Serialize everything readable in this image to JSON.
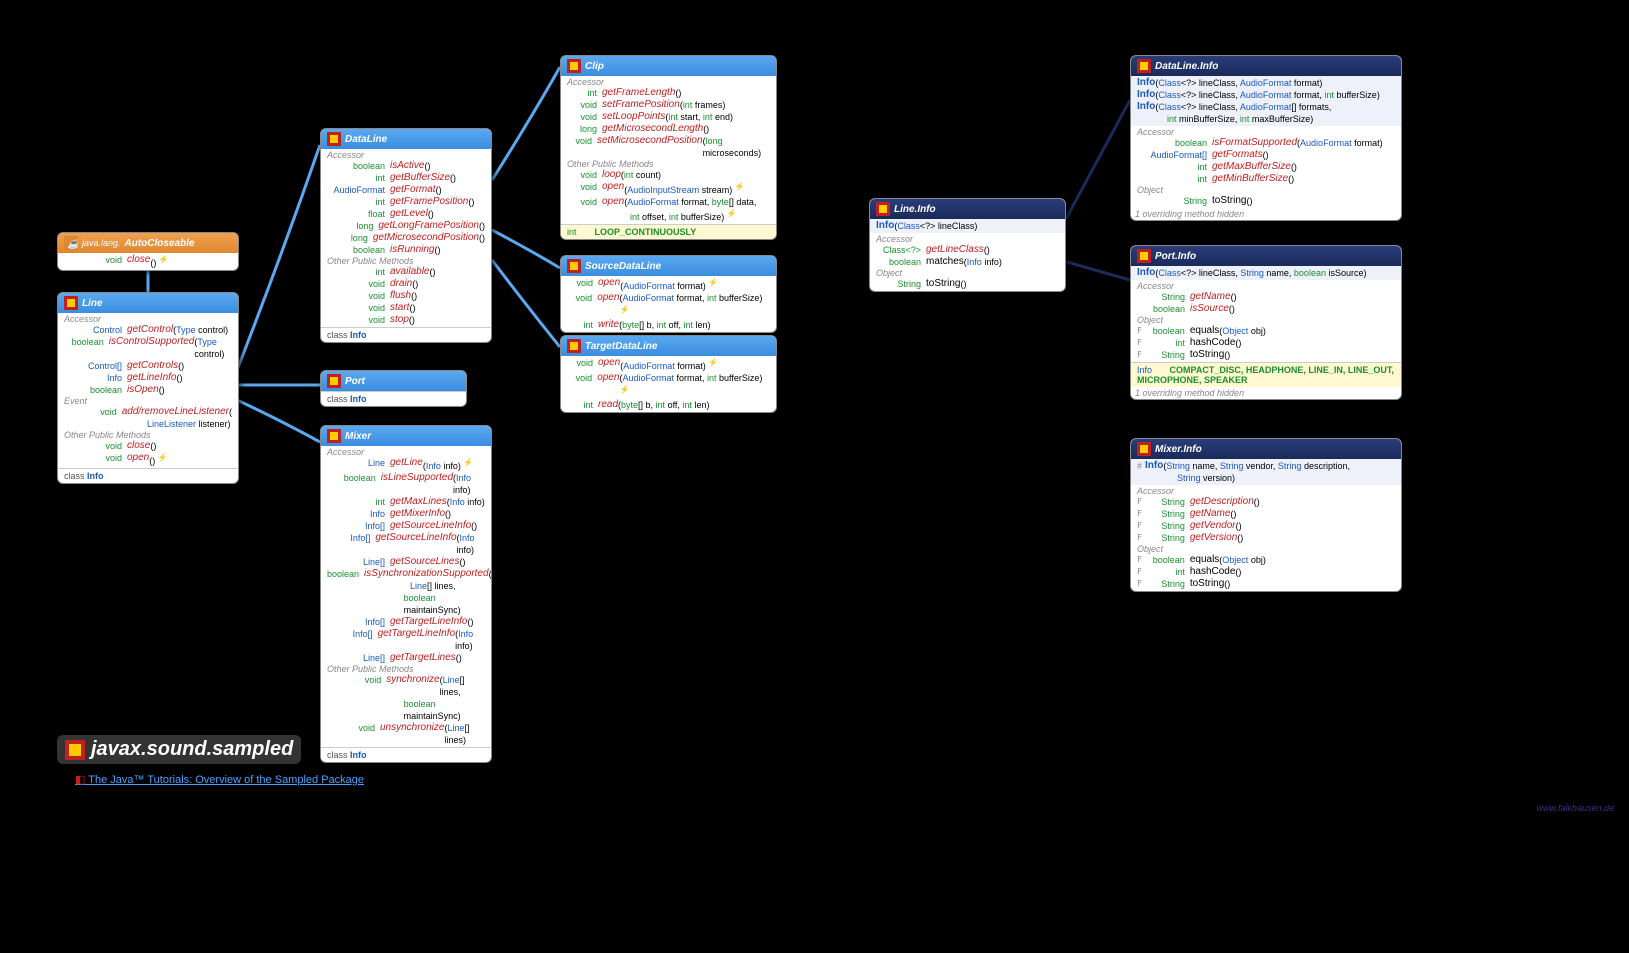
{
  "package": "javax.sound.sampled",
  "tutorial": "The Java™ Tutorials: Overview of the Sampled Package",
  "site": "www.falkhausen.de",
  "autocloseable": {
    "title": "AutoCloseable",
    "pkg": "java.lang.",
    "rows": [
      {
        "t": "void",
        "n": "close",
        "thr": true
      }
    ]
  },
  "line": {
    "title": "Line",
    "s1": "Accessor",
    "r1": [
      {
        "t": "Control",
        "tb": true,
        "n": "getControl",
        "p": "(Type control)"
      },
      {
        "t": "boolean",
        "n": "isControlSupported",
        "p": "(Type control)"
      },
      {
        "t": "Control[]",
        "tb": true,
        "n": "getControls",
        "p": "()"
      },
      {
        "t": "Info",
        "tb": true,
        "n": "getLineInfo",
        "p": "()"
      },
      {
        "t": "boolean",
        "n": "isOpen",
        "p": "()"
      }
    ],
    "s2": "Event",
    "r2": [
      {
        "t": "void",
        "n": "add/removeLineListener",
        "p": "(",
        "p2": "LineListener listener)"
      }
    ],
    "s3": "Other Public Methods",
    "r3": [
      {
        "t": "void",
        "n": "close",
        "p": "()"
      },
      {
        "t": "void",
        "n": "open",
        "p": "()",
        "thr": true
      }
    ],
    "footer_kw": "class",
    "footer_link": "Info"
  },
  "dataline": {
    "title": "DataLine",
    "s1": "Accessor",
    "r1": [
      {
        "t": "boolean",
        "n": "isActive",
        "p": "()"
      },
      {
        "t": "int",
        "n": "getBufferSize",
        "p": "()"
      },
      {
        "t": "AudioFormat",
        "tb": true,
        "n": "getFormat",
        "p": "()"
      },
      {
        "t": "int",
        "n": "getFramePosition",
        "p": "()"
      },
      {
        "t": "float",
        "n": "getLevel",
        "p": "()"
      },
      {
        "t": "long",
        "n": "getLongFramePosition",
        "p": "()"
      },
      {
        "t": "long",
        "n": "getMicrosecondPosition",
        "p": "()"
      },
      {
        "t": "boolean",
        "n": "isRunning",
        "p": "()"
      }
    ],
    "s2": "Other Public Methods",
    "r2": [
      {
        "t": "int",
        "n": "available",
        "p": "()"
      },
      {
        "t": "void",
        "n": "drain",
        "p": "()"
      },
      {
        "t": "void",
        "n": "flush",
        "p": "()"
      },
      {
        "t": "void",
        "n": "start",
        "p": "()"
      },
      {
        "t": "void",
        "n": "stop",
        "p": "()"
      }
    ],
    "footer_kw": "class",
    "footer_link": "Info"
  },
  "port": {
    "title": "Port",
    "footer_kw": "class",
    "footer_link": "Info"
  },
  "mixer": {
    "title": "Mixer",
    "s1": "Accessor",
    "r1": [
      {
        "t": "Line",
        "tb": true,
        "n": "getLine",
        "p": "(Info info)",
        "thr": true
      },
      {
        "t": "boolean",
        "n": "isLineSupported",
        "p": "(Info info)"
      },
      {
        "t": "int",
        "n": "getMaxLines",
        "p": "(Info info)"
      },
      {
        "t": "Info",
        "tb": true,
        "n": "getMixerInfo",
        "p": "()"
      },
      {
        "t": "Info[]",
        "tb": true,
        "n": "getSourceLineInfo",
        "p": "()"
      },
      {
        "t": "Info[]",
        "tb": true,
        "n": "getSourceLineInfo",
        "p": "(Info info)"
      },
      {
        "t": "Line[]",
        "tb": true,
        "n": "getSourceLines",
        "p": "()"
      },
      {
        "t": "boolean",
        "n": "isSynchronizationSupported",
        "p": "(",
        "p2": "Line[] lines,",
        "p3": "boolean maintainSync)"
      },
      {
        "t": "Info[]",
        "tb": true,
        "n": "getTargetLineInfo",
        "p": "()"
      },
      {
        "t": "Info[]",
        "tb": true,
        "n": "getTargetLineInfo",
        "p": "(Info info)"
      },
      {
        "t": "Line[]",
        "tb": true,
        "n": "getTargetLines",
        "p": "()"
      }
    ],
    "s2": "Other Public Methods",
    "r2": [
      {
        "t": "void",
        "n": "synchronize",
        "p": "(Line[] lines,",
        "p2": "boolean maintainSync)"
      },
      {
        "t": "void",
        "n": "unsynchronize",
        "p": "(Line[] lines)"
      }
    ],
    "footer_kw": "class",
    "footer_link": "Info"
  },
  "clip": {
    "title": "Clip",
    "s1": "Accessor",
    "r1": [
      {
        "t": "int",
        "n": "getFrameLength",
        "p": "()"
      },
      {
        "t": "void",
        "n": "setFramePosition",
        "p": "(int frames)"
      },
      {
        "t": "void",
        "n": "setLoopPoints",
        "p": "(int start, int end)"
      },
      {
        "t": "long",
        "n": "getMicrosecondLength",
        "p": "()"
      },
      {
        "t": "void",
        "n": "setMicrosecondPosition",
        "p": "(long microseconds)"
      }
    ],
    "s2": "Other Public Methods",
    "r2": [
      {
        "t": "void",
        "n": "loop",
        "p": "(int count)"
      },
      {
        "t": "void",
        "n": "open",
        "p": "(AudioInputStream stream)",
        "thr": true
      },
      {
        "t": "void",
        "n": "open",
        "p": "(AudioFormat format, byte[] data,",
        "p2": "int offset, int bufferSize)",
        "thr": true
      }
    ],
    "const_t": "int",
    "const_n": "LOOP_CONTINUOUSLY"
  },
  "sourcedataline": {
    "title": "SourceDataLine",
    "r": [
      {
        "t": "void",
        "n": "open",
        "p": "(AudioFormat format)",
        "thr": true
      },
      {
        "t": "void",
        "n": "open",
        "p": "(AudioFormat format, int bufferSize)",
        "thr": true
      },
      {
        "t": "int",
        "n": "write",
        "p": "(byte[] b, int off, int len)"
      }
    ]
  },
  "targetdataline": {
    "title": "TargetDataLine",
    "r": [
      {
        "t": "void",
        "n": "open",
        "p": "(AudioFormat format)",
        "thr": true
      },
      {
        "t": "void",
        "n": "open",
        "p": "(AudioFormat format, int bufferSize)",
        "thr": true
      },
      {
        "t": "int",
        "n": "read",
        "p": "(byte[] b, int off, int len)"
      }
    ]
  },
  "lineinfo": {
    "title": "Line.Info",
    "ctor": "Info (Class<?> lineClass)",
    "s1": "Accessor",
    "r1": [
      {
        "t": "Class<?>",
        "n": "getLineClass",
        "p": "()"
      },
      {
        "t": "boolean",
        "n": "matches",
        "p": "(Info info)"
      }
    ],
    "s2": "Object",
    "r2": [
      {
        "t": "String",
        "n": "toString",
        "p": "()"
      }
    ]
  },
  "datalineinfo": {
    "title": "DataLine.Info",
    "ctors": [
      "Info (Class<?> lineClass, AudioFormat format)",
      "Info (Class<?> lineClass, AudioFormat format, int bufferSize)",
      "Info (Class<?> lineClass, AudioFormat[] formats,",
      "        int minBufferSize, int maxBufferSize)"
    ],
    "s1": "Accessor",
    "r1": [
      {
        "t": "boolean",
        "n": "isFormatSupported",
        "p": "(AudioFormat format)"
      },
      {
        "t": "AudioFormat[]",
        "tb": true,
        "n": "getFormats",
        "p": "()"
      },
      {
        "t": "int",
        "n": "getMaxBufferSize",
        "p": "()"
      },
      {
        "t": "int",
        "n": "getMinBufferSize",
        "p": "()"
      }
    ],
    "s2": "Object",
    "r2": [
      {
        "t": "String",
        "n": "toString",
        "p": "()"
      }
    ],
    "note": "1 overriding method hidden"
  },
  "portinfo": {
    "title": "Port.Info",
    "ctor": "Info (Class<?> lineClass, String name, boolean isSource)",
    "s1": "Accessor",
    "r1": [
      {
        "t": "String",
        "n": "getName",
        "p": "()"
      },
      {
        "t": "boolean",
        "n": "isSource",
        "p": "()"
      }
    ],
    "s2": "Object",
    "r2": [
      {
        "f": "F",
        "t": "boolean",
        "n": "equals",
        "p": "(Object obj)"
      },
      {
        "f": "F",
        "t": "int",
        "n": "hashCode",
        "p": "()"
      },
      {
        "f": "F",
        "t": "String",
        "n": "toString",
        "p": "()"
      }
    ],
    "const_t": "Info",
    "const_n": "COMPACT_DISC, HEADPHONE, LINE_IN, LINE_OUT, MICROPHONE, SPEAKER",
    "note": "1 overriding method hidden"
  },
  "mixerinfo": {
    "title": "Mixer.Info",
    "ctor": "# Info (String name, String vendor, String description, String version)",
    "s1": "Accessor",
    "r1": [
      {
        "f": "F",
        "t": "String",
        "n": "getDescription",
        "p": "()"
      },
      {
        "f": "F",
        "t": "String",
        "n": "getName",
        "p": "()"
      },
      {
        "f": "F",
        "t": "String",
        "n": "getVendor",
        "p": "()"
      },
      {
        "f": "F",
        "t": "String",
        "n": "getVersion",
        "p": "()"
      }
    ],
    "s2": "Object",
    "r2": [
      {
        "f": "F",
        "t": "boolean",
        "n": "equals",
        "p": "(Object obj)"
      },
      {
        "f": "F",
        "t": "int",
        "n": "hashCode",
        "p": "()"
      },
      {
        "f": "F",
        "t": "String",
        "n": "toString",
        "p": "()"
      }
    ]
  }
}
